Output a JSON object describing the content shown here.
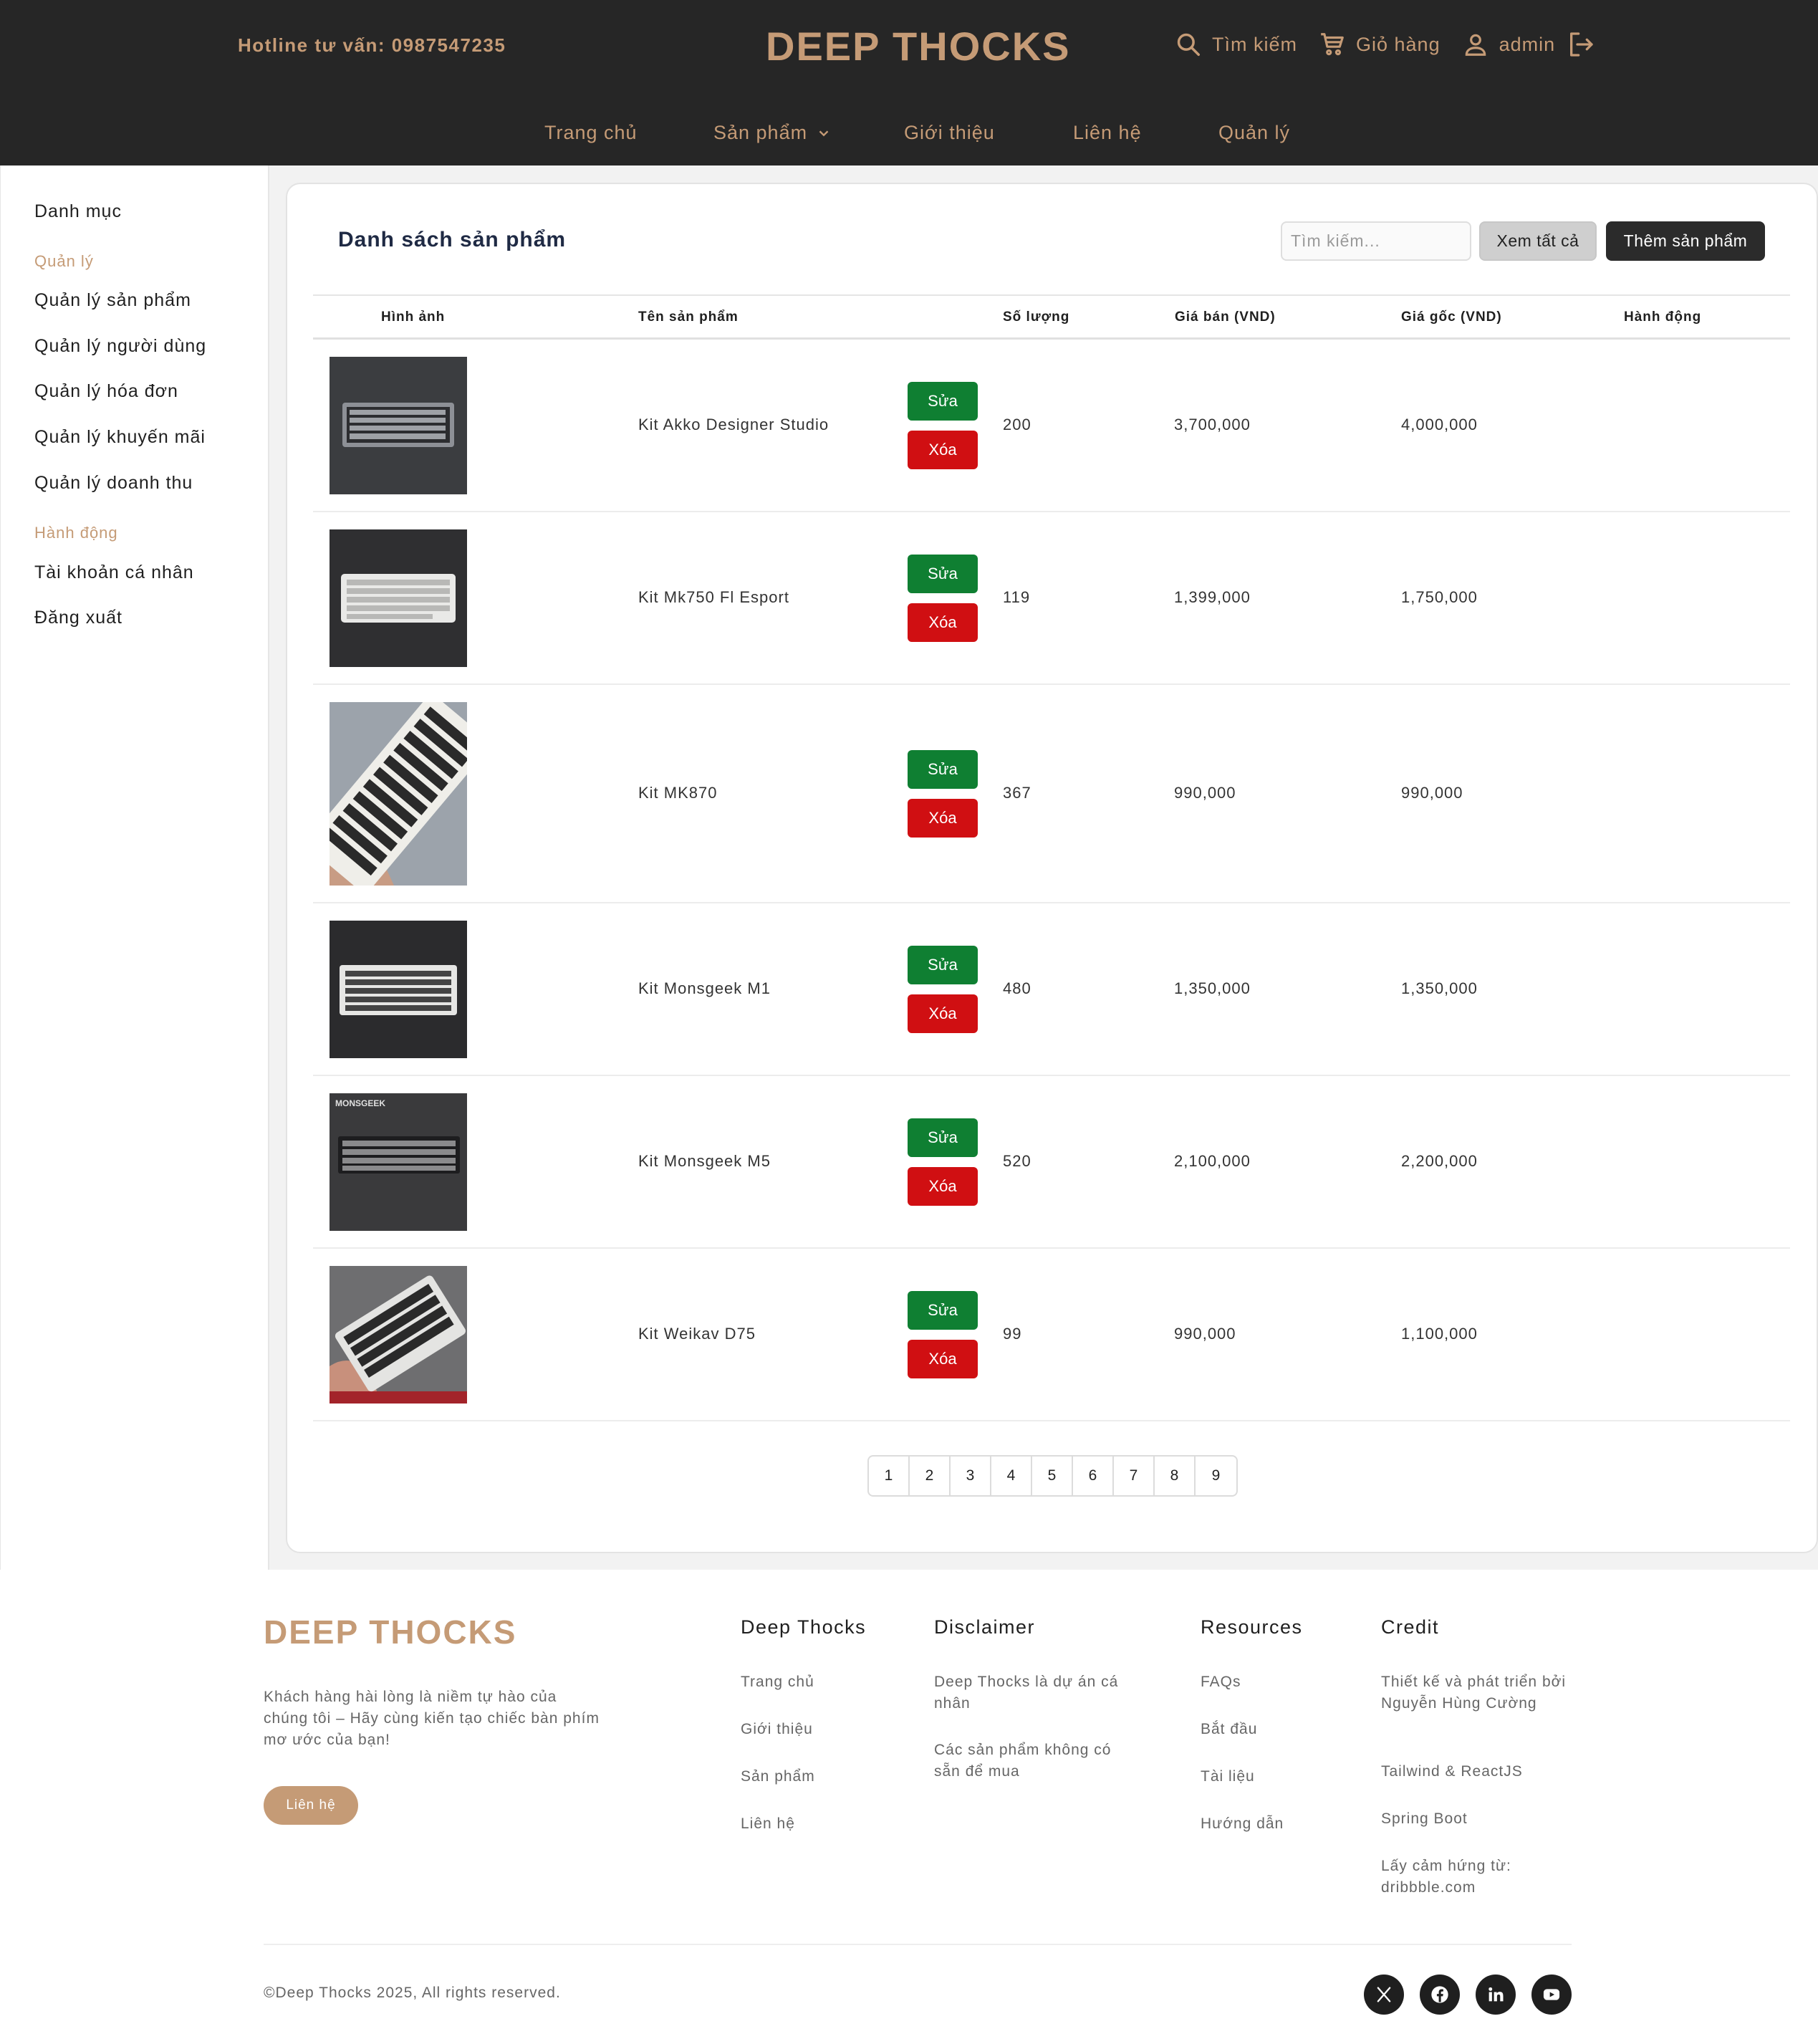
{
  "header": {
    "hotline_label": "Hotline tư vấn: 0987547235",
    "brand": "DEEP THOCKS",
    "search_label": "Tìm kiếm",
    "cart_label": "Giỏ hàng",
    "user_label": "admin",
    "icons": [
      "search-icon",
      "cart-icon",
      "user-icon",
      "logout-icon"
    ],
    "nav": [
      {
        "label": "Trang chủ"
      },
      {
        "label": "Sản phẩm"
      },
      {
        "label": "Giới thiệu"
      },
      {
        "label": "Liên hệ"
      },
      {
        "label": "Quản lý"
      }
    ]
  },
  "sidebar": {
    "title": "Danh mục",
    "group_manage": "Quản lý",
    "manage_items": [
      {
        "label": "Quản lý sản phẩm"
      },
      {
        "label": "Quản lý người dùng"
      },
      {
        "label": "Quản lý hóa đơn"
      },
      {
        "label": "Quản lý khuyến mãi"
      },
      {
        "label": "Quản lý doanh thu"
      }
    ],
    "group_actions": "Hành động",
    "action_items": [
      {
        "label": "Tài khoản cá nhân"
      },
      {
        "label": "Đăng xuất"
      }
    ]
  },
  "content": {
    "title": "Danh sách sản phẩm",
    "search_placeholder": "Tìm kiếm...",
    "view_all_label": "Xem tất cả",
    "add_label": "Thêm sản phẩm",
    "columns": [
      "Hình ảnh",
      "Tên sản phẩm",
      "Số lượng",
      "Giá bán (VND)",
      "Giá gốc (VND)",
      "Hành động"
    ],
    "edit_label": "Sửa",
    "delete_label": "Xóa",
    "products": [
      {
        "name": "Kit Akko Designer Studio",
        "qty": "200",
        "price": "3,700,000",
        "original": "4,000,000"
      },
      {
        "name": "Kit Mk750 Fl Esport",
        "qty": "119",
        "price": "1,399,000",
        "original": "1,750,000"
      },
      {
        "name": "Kit MK870",
        "qty": "367",
        "price": "990,000",
        "original": "990,000"
      },
      {
        "name": "Kit Monsgeek M1",
        "qty": "480",
        "price": "1,350,000",
        "original": "1,350,000"
      },
      {
        "name": "Kit Monsgeek M5",
        "qty": "520",
        "price": "2,100,000",
        "original": "2,200,000",
        "image_text": "MONSGEEK"
      },
      {
        "name": "Kit Weikav D75",
        "qty": "99",
        "price": "990,000",
        "original": "1,100,000"
      }
    ],
    "pages": [
      "1",
      "2",
      "3",
      "4",
      "5",
      "6",
      "7",
      "8",
      "9"
    ]
  },
  "footer": {
    "brand": "DEEP THOCKS",
    "tagline": "Khách hàng hài lòng là niềm tự hào của chúng tôi – Hãy cùng kiến tạo chiếc bàn phím mơ ước của bạn!",
    "contact_label": "Liên hệ",
    "columns": [
      {
        "title": "Deep Thocks",
        "links": [
          "Trang chủ",
          "Giới thiệu",
          "Sản phẩm",
          "Liên hệ"
        ]
      },
      {
        "title": "Disclaimer",
        "links": [
          "Deep Thocks là dự án cá nhân",
          "Các sản phẩm không có sẵn để mua"
        ]
      },
      {
        "title": "Resources",
        "links": [
          "FAQs",
          "Bắt đầu",
          "Tài liệu",
          "Hướng dẫn"
        ]
      },
      {
        "title": "Credit",
        "links": [
          "Thiết kế và phát triển bởi Nguyễn Hùng Cường",
          "Tailwind & ReactJS",
          "Spring Boot",
          "Lấy cảm hứng từ: dribbble.com"
        ]
      }
    ],
    "copyright": "©Deep Thocks 2025, All rights reserved.",
    "social": [
      "x-icon",
      "facebook-icon",
      "linkedin-icon",
      "youtube-icon"
    ]
  },
  "colors": {
    "header_bg": "#262626",
    "accent": "#c59b76",
    "edit": "#0f7f32",
    "delete": "#d00f12"
  }
}
